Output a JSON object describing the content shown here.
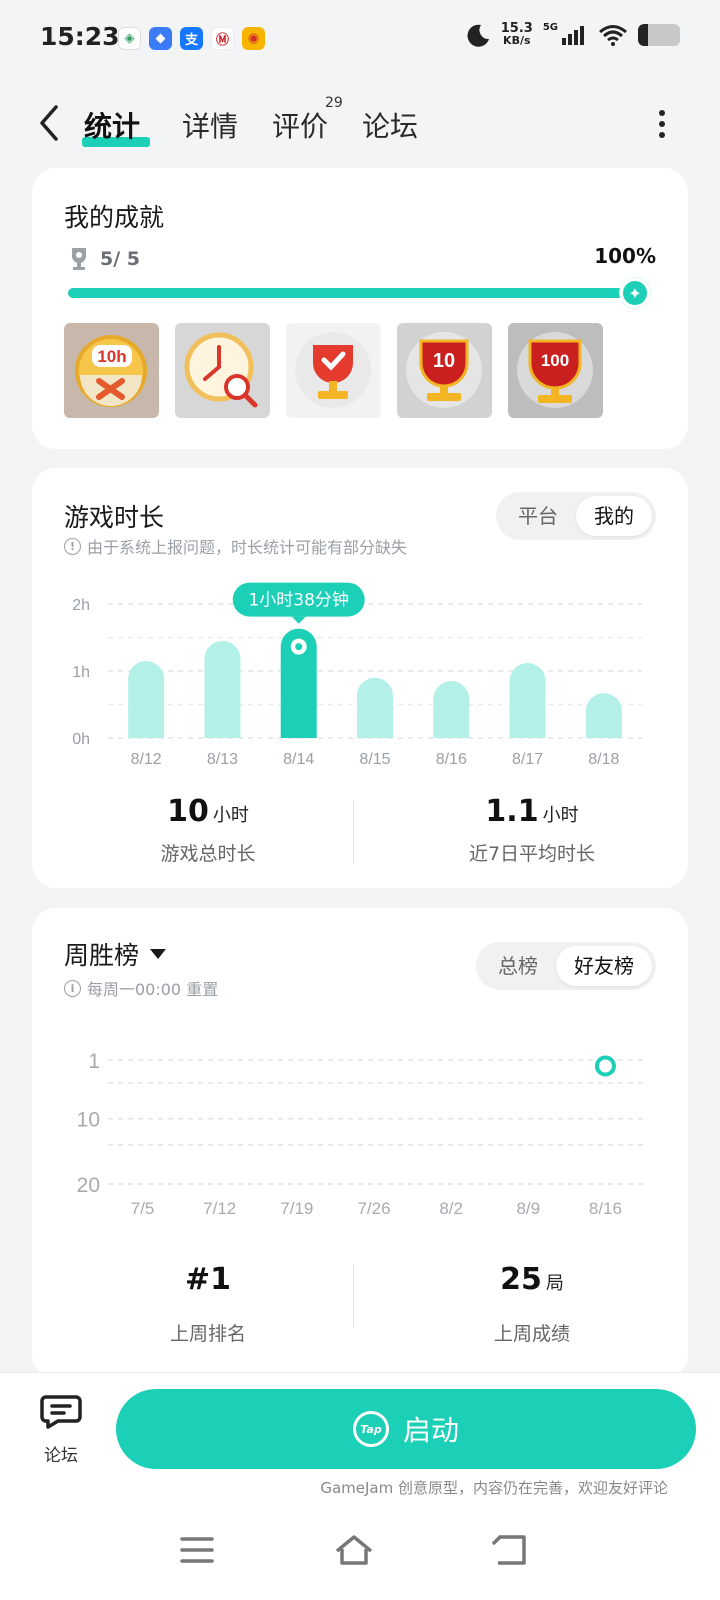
{
  "status": {
    "time": "15:23",
    "net_speed_value": "15.3",
    "net_speed_unit": "KB/s",
    "signal_label": "5G"
  },
  "nav": {
    "tabs": [
      {
        "label": "统计",
        "active": true
      },
      {
        "label": "详情",
        "active": false
      },
      {
        "label": "评价",
        "active": false
      },
      {
        "label": "论坛",
        "active": false
      }
    ],
    "review_count": "29"
  },
  "achievement": {
    "title": "我的成就",
    "count": "5/ 5",
    "percent": "100%",
    "progress": 1.0,
    "badges": [
      {
        "name": "10h-badge",
        "text": "10h"
      },
      {
        "name": "clock-search-badge",
        "text": ""
      },
      {
        "name": "trophy-check-badge",
        "text": ""
      },
      {
        "name": "trophy-10-badge",
        "text": "10"
      },
      {
        "name": "trophy-100-badge",
        "text": "100"
      }
    ]
  },
  "playtime": {
    "title": "游戏时长",
    "hint": "由于系统上报问题，时长统计可能有部分缺失",
    "segment": [
      "平台",
      "我的"
    ],
    "selected_segment": "我的",
    "tooltip": "1小时38分钟",
    "total_value": "10",
    "total_unit": "小时",
    "total_label": "游戏总时长",
    "avg_value": "1.1",
    "avg_unit": "小时",
    "avg_label": "近7日平均时长"
  },
  "ranking": {
    "title": "周胜榜",
    "hint": "每周一00:00 重置",
    "segment": [
      "总榜",
      "好友榜"
    ],
    "selected_segment": "好友榜",
    "rank_value": "#1",
    "rank_label": "上周排名",
    "score_value": "25",
    "score_unit": "局",
    "score_label": "上周成绩"
  },
  "chart_data": [
    {
      "type": "bar",
      "categories": [
        "8/12",
        "8/13",
        "8/14",
        "8/15",
        "8/16",
        "8/17",
        "8/18"
      ],
      "values": [
        1.15,
        1.45,
        1.633,
        0.9,
        0.85,
        1.12,
        0.67
      ],
      "highlight_index": 2,
      "y_ticks": [
        "0h",
        "1h",
        "2h"
      ],
      "ylim": [
        0,
        2
      ],
      "colors": {
        "bar": "#b3f0e7",
        "highlight": "#1ccfb7"
      }
    },
    {
      "type": "line",
      "x": [
        "7/5",
        "7/12",
        "7/19",
        "7/26",
        "8/2",
        "8/9",
        "8/16"
      ],
      "values": [
        null,
        null,
        null,
        null,
        null,
        null,
        1
      ],
      "y_ticks": [
        "1",
        "10",
        "20"
      ],
      "ylim": [
        1,
        20
      ],
      "y_inverted": true,
      "colors": {
        "point": "#1ccfb7"
      }
    }
  ],
  "bottom": {
    "forum_label": "论坛",
    "launch_label": "启动",
    "tap_label": "Tap",
    "footnote": "GameJam 创意原型，内容仍在完善，欢迎友好评论"
  },
  "colors": {
    "accent": "#1ccfb7",
    "bar_light": "#b3f0e7",
    "background": "#f3f4f6"
  }
}
